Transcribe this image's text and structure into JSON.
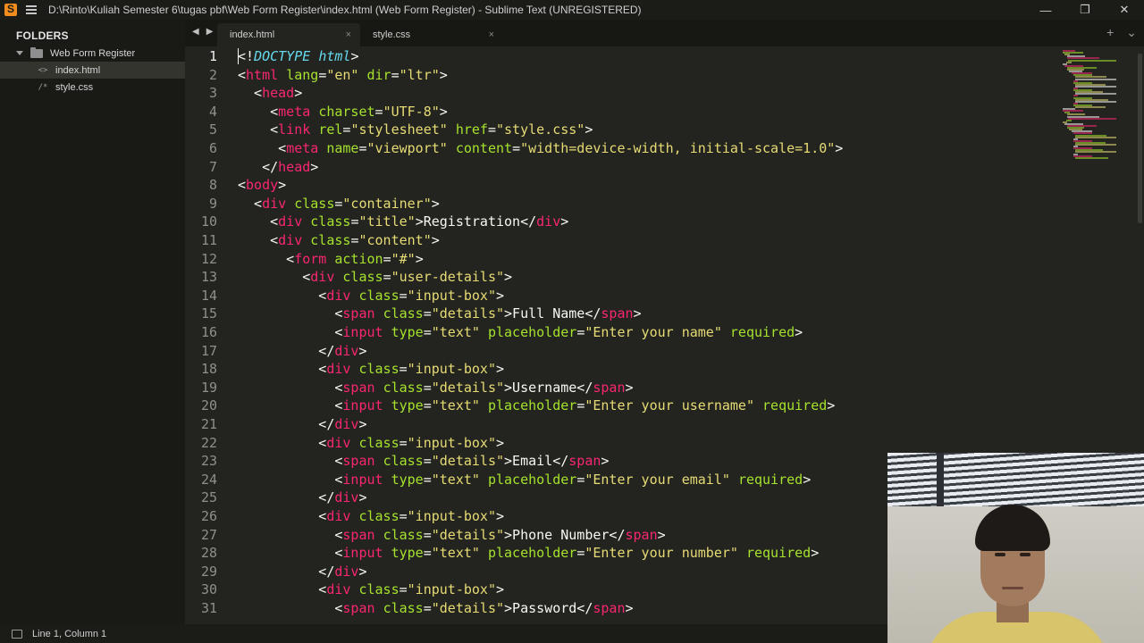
{
  "window": {
    "title": "D:\\Rinto\\Kuliah Semester 6\\tugas pbf\\Web Form Register\\index.html (Web Form Register) - Sublime Text (UNREGISTERED)",
    "controls": {
      "minimize": "—",
      "maximize": "❐",
      "close": "✕"
    }
  },
  "sidebar": {
    "header": "FOLDERS",
    "folder": "Web Form Register",
    "files": [
      {
        "glyph": "<>",
        "name": "index.html"
      },
      {
        "glyph": "/*",
        "name": "style.css"
      }
    ]
  },
  "tabs": [
    {
      "label": "index.html",
      "close": "×"
    },
    {
      "label": "style.css",
      "close": "×"
    }
  ],
  "tabbar": {
    "back": "◀",
    "forward": "▶",
    "new_tab": "+",
    "more": "⌄"
  },
  "editor": {
    "line_numbers": [
      "1",
      "2",
      "3",
      "4",
      "5",
      "6",
      "7",
      "8",
      "9",
      "10",
      "11",
      "12",
      "13",
      "14",
      "15",
      "16",
      "17",
      "18",
      "19",
      "20",
      "21",
      "22",
      "23",
      "24",
      "25",
      "26",
      "27",
      "28",
      "29",
      "30",
      "31"
    ],
    "lines": [
      "<!DOCTYPE html>",
      "<html lang=\"en\" dir=\"ltr\">",
      "  <head>",
      "    <meta charset=\"UTF-8\">",
      "    <link rel=\"stylesheet\" href=\"style.css\">",
      "     <meta name=\"viewport\" content=\"width=device-width, initial-scale=1.0\">",
      "   </head>",
      "<body>",
      "  <div class=\"container\">",
      "    <div class=\"title\">Registration</div>",
      "    <div class=\"content\">",
      "      <form action=\"#\">",
      "        <div class=\"user-details\">",
      "          <div class=\"input-box\">",
      "            <span class=\"details\">Full Name</span>",
      "            <input type=\"text\" placeholder=\"Enter your name\" required>",
      "          </div>",
      "          <div class=\"input-box\">",
      "            <span class=\"details\">Username</span>",
      "            <input type=\"text\" placeholder=\"Enter your username\" required>",
      "          </div>",
      "          <div class=\"input-box\">",
      "            <span class=\"details\">Email</span>",
      "            <input type=\"text\" placeholder=\"Enter your email\" required>",
      "          </div>",
      "          <div class=\"input-box\">",
      "            <span class=\"details\">Phone Number</span>",
      "            <input type=\"text\" placeholder=\"Enter your number\" required>",
      "          </div>",
      "          <div class=\"input-box\">",
      "            <span class=\"details\">Password</span>"
    ]
  },
  "status": {
    "position": "Line 1, Column 1"
  },
  "colors": {
    "background": "#23241f",
    "tag": "#f92672",
    "attribute": "#a6e22e",
    "string": "#e6db74",
    "doctype": "#66d9ef",
    "text": "#f8f8f2"
  }
}
